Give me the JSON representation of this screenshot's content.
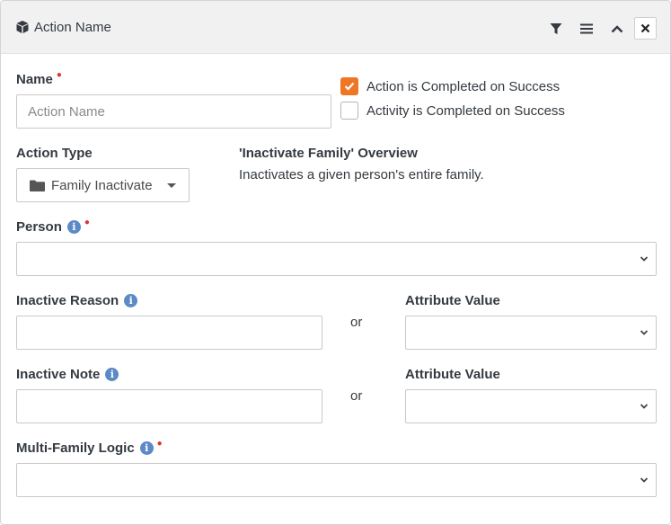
{
  "header": {
    "title": "Action Name",
    "icons": [
      "cube-icon",
      "filter-icon",
      "menu-icon",
      "chevron-up-icon",
      "close-icon"
    ]
  },
  "name_field": {
    "label": "Name",
    "placeholder": "Action Name",
    "value": ""
  },
  "checkboxes": [
    {
      "label": "Action is Completed on Success",
      "checked": true
    },
    {
      "label": "Activity is Completed on Success",
      "checked": false
    }
  ],
  "action_type": {
    "label": "Action Type",
    "value": "Family Inactivate"
  },
  "overview": {
    "title": "'Inactivate Family' Overview",
    "text": "Inactivates a given person's entire family."
  },
  "person": {
    "label": "Person",
    "value": ""
  },
  "inactive_reason": {
    "label": "Inactive Reason",
    "value": "",
    "or": "or",
    "attribute_label": "Attribute Value",
    "attribute_value": ""
  },
  "inactive_note": {
    "label": "Inactive Note",
    "value": "",
    "or": "or",
    "attribute_label": "Attribute Value",
    "attribute_value": ""
  },
  "multi_family_logic": {
    "label": "Multi-Family Logic",
    "value": ""
  },
  "colors": {
    "accent": "#ee7624",
    "required": "#dd3333",
    "info": "#5b8ac6",
    "header_bg": "#f1f1f1"
  }
}
